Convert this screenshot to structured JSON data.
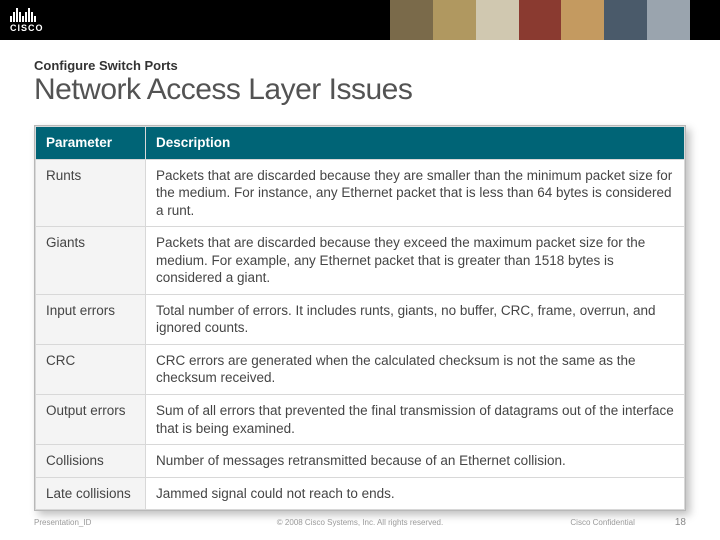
{
  "brand": {
    "name": "CISCO"
  },
  "header": {
    "pretitle": "Configure Switch Ports",
    "title": "Network Access Layer Issues"
  },
  "table": {
    "columns": [
      "Parameter",
      "Description"
    ],
    "rows": [
      {
        "param": "Runts",
        "desc": "Packets that are discarded because they are smaller than the minimum packet size for the medium. For instance, any Ethernet packet that is less than 64 bytes is considered a runt."
      },
      {
        "param": "Giants",
        "desc": "Packets that are discarded because they exceed the maximum packet size for the medium. For example, any Ethernet packet that is greater than 1518 bytes is considered a giant."
      },
      {
        "param": "Input errors",
        "desc": "Total number of errors. It includes runts, giants, no buffer, CRC, frame, overrun, and ignored counts."
      },
      {
        "param": "CRC",
        "desc": "CRC errors are generated when the calculated checksum is not the same as the checksum received."
      },
      {
        "param": "Output errors",
        "desc": "Sum of all errors that prevented the final transmission of datagrams out of the interface that is being examined."
      },
      {
        "param": "Collisions",
        "desc": "Number of messages retransmitted because of an Ethernet collision."
      },
      {
        "param": "Late collisions",
        "desc": "Jammed signal could not reach to ends."
      }
    ]
  },
  "footer": {
    "left": "Presentation_ID",
    "center": "© 2008 Cisco Systems, Inc. All rights reserved.",
    "confidential": "Cisco Confidential",
    "page": "18"
  }
}
